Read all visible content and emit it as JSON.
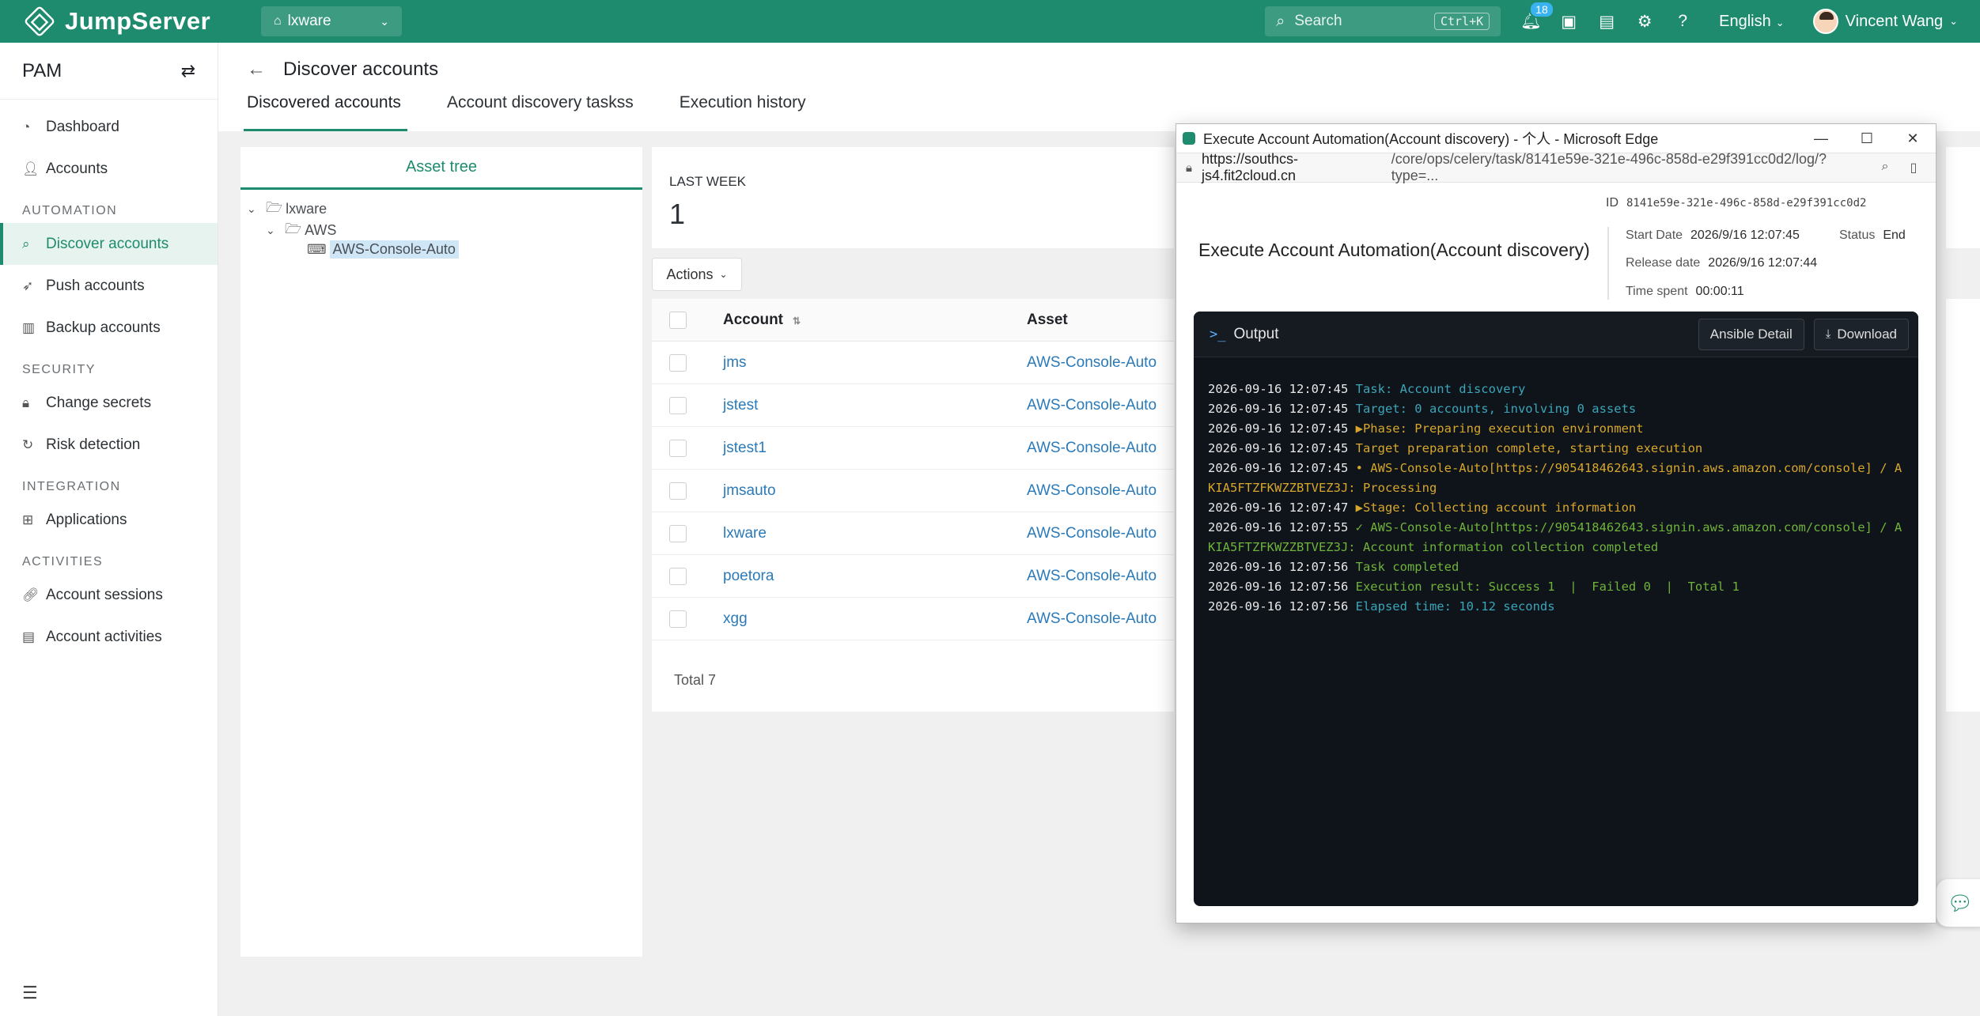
{
  "topbar": {
    "brand": "JumpServer",
    "org": "lxware",
    "search_placeholder": "Search",
    "search_shortcut": "Ctrl+K",
    "notif_count": "18",
    "language": "English",
    "user_name": "Vincent Wang"
  },
  "sidebar": {
    "title": "PAM",
    "items": [
      {
        "label": "Dashboard",
        "icon": "dashboard-icon"
      },
      {
        "label": "Accounts",
        "icon": "accounts-icon"
      }
    ],
    "sections": [
      {
        "title": "AUTOMATION",
        "items": [
          {
            "label": "Discover accounts",
            "icon": "search-icon",
            "active": true
          },
          {
            "label": "Push accounts",
            "icon": "send-icon"
          },
          {
            "label": "Backup accounts",
            "icon": "backup-icon"
          }
        ]
      },
      {
        "title": "SECURITY",
        "items": [
          {
            "label": "Change secrets",
            "icon": "lock-icon"
          },
          {
            "label": "Risk detection",
            "icon": "history-icon"
          }
        ]
      },
      {
        "title": "INTEGRATION",
        "items": [
          {
            "label": "Applications",
            "icon": "grid-icon"
          }
        ]
      },
      {
        "title": "ACTIVITIES",
        "items": [
          {
            "label": "Account sessions",
            "icon": "link-icon"
          },
          {
            "label": "Account activities",
            "icon": "list-icon"
          }
        ]
      }
    ]
  },
  "page": {
    "title": "Discover accounts",
    "tabs": [
      "Discovered accounts",
      "Account discovery taskss",
      "Execution history"
    ]
  },
  "tree": {
    "tab": "Asset tree",
    "root": "lxware",
    "child": "AWS",
    "leaf": "AWS-Console-Auto"
  },
  "stats": {
    "label": "LAST WEEK",
    "value": "1"
  },
  "actions_label": "Actions",
  "table": {
    "headers": {
      "account": "Account",
      "asset": "Asset"
    },
    "rows": [
      {
        "account": "jms",
        "asset": "AWS-Console-Auto"
      },
      {
        "account": "jstest",
        "asset": "AWS-Console-Auto"
      },
      {
        "account": "jstest1",
        "asset": "AWS-Console-Auto"
      },
      {
        "account": "jmsauto",
        "asset": "AWS-Console-Auto"
      },
      {
        "account": "lxware",
        "asset": "AWS-Console-Auto"
      },
      {
        "account": "poetora",
        "asset": "AWS-Console-Auto"
      },
      {
        "account": "xgg",
        "asset": "AWS-Console-Auto"
      }
    ],
    "total": "Total 7"
  },
  "popup": {
    "window_title": "Execute Account Automation(Account discovery) - 个人 - Microsoft Edge",
    "url_host": "https://southcs-js4.fit2cloud.cn",
    "url_path": "/core/ops/celery/task/8141e59e-321e-496c-858d-e29f391cc0d2/log/?type=...",
    "job_title": "Execute Account Automation(Account discovery)",
    "id_label": "ID",
    "id_value": "8141e59e-321e-496c-858d-e29f391cc0d2",
    "start_label": "Start Date",
    "start_value": "2026/9/16 12:07:45",
    "status_label": "Status",
    "status_value": "End",
    "release_label": "Release date",
    "release_value": "2026/9/16 12:07:44",
    "spent_label": "Time spent",
    "spent_value": "00:00:11",
    "output_title": "Output",
    "ansible_btn": "Ansible Detail",
    "download_btn": "Download",
    "log": [
      {
        "ts": "2026-09-16 12:07:45",
        "text": "Task: Account discovery",
        "color": "cyan"
      },
      {
        "ts": "2026-09-16 12:07:45",
        "text": "Target: 0 accounts, involving 0 assets",
        "color": "cyan"
      },
      {
        "ts": "2026-09-16 12:07:45",
        "text": "▶Phase: Preparing execution environment",
        "color": "yellow"
      },
      {
        "ts": "2026-09-16 12:07:45",
        "text": "Target preparation complete, starting execution",
        "color": "yellow"
      },
      {
        "ts": "2026-09-16 12:07:45",
        "text": "• AWS-Console-Auto[https://905418462643.signin.aws.amazon.com/console] / AKIA5FTZFKWZZBTVEZ3J: Processing",
        "color": "yellow"
      },
      {
        "ts": "2026-09-16 12:07:47",
        "text": "▶Stage: Collecting account information",
        "color": "yellow"
      },
      {
        "ts": "2026-09-16 12:07:55",
        "text": "✓ AWS-Console-Auto[https://905418462643.signin.aws.amazon.com/console] / AKIA5FTZFKWZZBTVEZ3J: Account information collection completed",
        "color": "green"
      },
      {
        "ts": "2026-09-16 12:07:56",
        "text": "Task completed",
        "color": "green"
      },
      {
        "ts": "2026-09-16 12:07:56",
        "text": "Execution result: Success 1  |  Failed 0  |  Total 1",
        "color": "green"
      },
      {
        "ts": "2026-09-16 12:07:56",
        "text": "Elapsed time: 10.12 seconds",
        "color": "cyan"
      }
    ]
  }
}
